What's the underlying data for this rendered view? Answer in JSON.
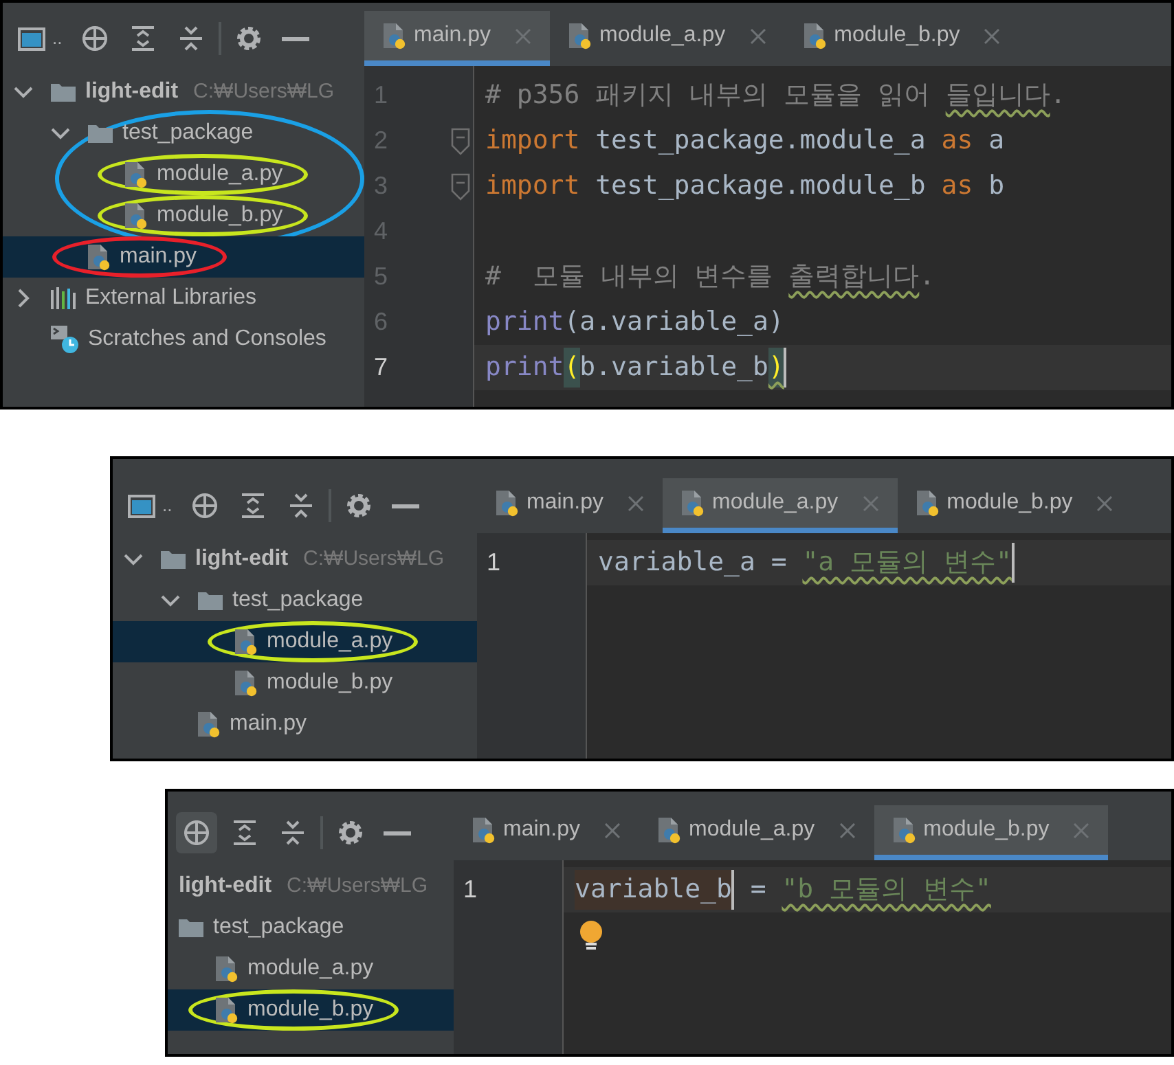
{
  "panels": [
    {
      "toolbar": [
        {
          "kind": "window",
          "label": "..",
          "hovered": false
        },
        {
          "kind": "locate",
          "hovered": false
        },
        {
          "kind": "expand",
          "hovered": false
        },
        {
          "kind": "collapse",
          "hovered": false
        },
        {
          "kind": "separator",
          "hovered": false
        },
        {
          "kind": "settings",
          "hovered": false
        },
        {
          "kind": "hide",
          "hovered": false
        }
      ],
      "tabs": [
        {
          "label": "main.py",
          "selected": true
        },
        {
          "label": "module_a.py",
          "selected": false
        },
        {
          "label": "module_b.py",
          "selected": false
        }
      ],
      "tree": {
        "hscrolled": false,
        "items": [
          {
            "label": "light-edit",
            "path": "C:₩Users₩LG",
            "kind": "folder",
            "expanded": true,
            "selected": false,
            "children": [
              {
                "label": "test_package",
                "kind": "folder",
                "expanded": true,
                "selected": false,
                "annotation": {
                  "kind": "group",
                  "color": "#1aa0e6"
                },
                "children": [
                  {
                    "label": "module_a.py",
                    "kind": "python",
                    "selected": false,
                    "annotation": {
                      "kind": "row",
                      "color": "#c8e61e"
                    }
                  },
                  {
                    "label": "module_b.py",
                    "kind": "python",
                    "selected": false,
                    "annotation": {
                      "kind": "row",
                      "color": "#c8e61e"
                    }
                  }
                ]
              },
              {
                "label": "main.py",
                "kind": "python",
                "selected": true,
                "annotation": {
                  "kind": "row",
                  "color": "#e8202a"
                }
              }
            ]
          },
          {
            "label": "External Libraries",
            "kind": "libraries",
            "expanded": false,
            "selected": false
          },
          {
            "label": "Scratches and Consoles",
            "kind": "scratches",
            "selected": false
          }
        ]
      },
      "editor": {
        "bulb": false,
        "lines": [
          {
            "number": "1",
            "current": false,
            "fold": false,
            "segments": [
              {
                "text": "# p356 패키지 내부의 모듈을 읽어 ",
                "kind": "comment"
              },
              {
                "text": "들입니다",
                "kind": "comment",
                "warn": true
              },
              {
                "text": ".",
                "kind": "comment"
              }
            ]
          },
          {
            "number": "2",
            "current": false,
            "fold": true,
            "segments": [
              {
                "text": "import",
                "kind": "keyword"
              },
              {
                "text": " test_package.module_a ",
                "kind": "plain"
              },
              {
                "text": "as",
                "kind": "keyword"
              },
              {
                "text": " a",
                "kind": "plain"
              }
            ]
          },
          {
            "number": "3",
            "current": false,
            "fold": true,
            "segments": [
              {
                "text": "import",
                "kind": "keyword"
              },
              {
                "text": " test_package.module_b ",
                "kind": "plain"
              },
              {
                "text": "as",
                "kind": "keyword"
              },
              {
                "text": " b",
                "kind": "plain"
              }
            ]
          },
          {
            "number": "4",
            "current": false,
            "fold": false
          },
          {
            "number": "5",
            "current": false,
            "fold": false,
            "segments": [
              {
                "text": "#  모듈 내부의 변수를 ",
                "kind": "comment"
              },
              {
                "text": "출력합니다",
                "kind": "comment",
                "warn": true
              },
              {
                "text": ".",
                "kind": "comment"
              }
            ]
          },
          {
            "number": "6",
            "current": false,
            "fold": false,
            "segments": [
              {
                "text": "print",
                "kind": "builtin"
              },
              {
                "text": "(a.variable_a)",
                "kind": "plain"
              }
            ]
          },
          {
            "number": "7",
            "current": true,
            "fold": false,
            "segments": [
              {
                "text": "print",
                "kind": "builtin"
              },
              {
                "text": "(",
                "kind": "brace",
                "matched": true
              },
              {
                "text": "b.variable_b",
                "kind": "plain"
              },
              {
                "text": ")",
                "kind": "brace",
                "matched": true,
                "warn": true,
                "caret": true
              }
            ]
          }
        ]
      }
    },
    {
      "toolbar": [
        {
          "kind": "window",
          "label": "..",
          "hovered": false
        },
        {
          "kind": "locate",
          "hovered": false
        },
        {
          "kind": "expand",
          "hovered": false
        },
        {
          "kind": "collapse",
          "hovered": false
        },
        {
          "kind": "separator",
          "hovered": false
        },
        {
          "kind": "settings",
          "hovered": false
        },
        {
          "kind": "hide",
          "hovered": false
        }
      ],
      "tabs": [
        {
          "label": "main.py",
          "selected": false
        },
        {
          "label": "module_a.py",
          "selected": true
        },
        {
          "label": "module_b.py",
          "selected": false
        }
      ],
      "tree": {
        "hscrolled": false,
        "items": [
          {
            "label": "light-edit",
            "path": "C:₩Users₩LG",
            "kind": "folder",
            "expanded": true,
            "selected": false,
            "children": [
              {
                "label": "test_package",
                "kind": "folder",
                "expanded": true,
                "selected": false,
                "children": [
                  {
                    "label": "module_a.py",
                    "kind": "python",
                    "selected": true,
                    "annotation": {
                      "kind": "row",
                      "color": "#c8e61e"
                    }
                  },
                  {
                    "label": "module_b.py",
                    "kind": "python",
                    "selected": false
                  }
                ]
              },
              {
                "label": "main.py",
                "kind": "python",
                "selected": false
              }
            ]
          }
        ]
      },
      "editor": {
        "bulb": false,
        "lines": [
          {
            "number": "1",
            "current": true,
            "fold": false,
            "segments": [
              {
                "text": "variable_a = ",
                "kind": "plain"
              },
              {
                "text": "\"a 모듈의 변수\"",
                "kind": "string",
                "warn": true,
                "caret": true
              }
            ]
          }
        ]
      }
    },
    {
      "toolbar": [
        {
          "kind": "locate",
          "hovered": true
        },
        {
          "kind": "expand",
          "hovered": false
        },
        {
          "kind": "collapse",
          "hovered": false
        },
        {
          "kind": "separator",
          "hovered": false
        },
        {
          "kind": "settings",
          "hovered": false
        },
        {
          "kind": "hide",
          "hovered": false
        }
      ],
      "tabs": [
        {
          "label": "main.py",
          "selected": false
        },
        {
          "label": "module_a.py",
          "selected": false
        },
        {
          "label": "module_b.py",
          "selected": true
        }
      ],
      "tree": {
        "hscrolled": true,
        "items": [
          {
            "label": "light-edit",
            "path": "C:₩Users₩LG",
            "kind": "folder",
            "selected": false,
            "children": [
              {
                "label": "test_package",
                "kind": "folder",
                "selected": false,
                "children": [
                  {
                    "label": "module_a.py",
                    "kind": "python",
                    "selected": false
                  },
                  {
                    "label": "module_b.py",
                    "kind": "python",
                    "selected": true,
                    "annotation": {
                      "kind": "row",
                      "color": "#c8e61e"
                    }
                  }
                ]
              }
            ]
          }
        ]
      },
      "editor": {
        "bulb": true,
        "lines": [
          {
            "number": "1",
            "current": true,
            "fold": false,
            "segments": [
              {
                "text": "variable_b",
                "kind": "plain",
                "marked": true,
                "caret": true
              },
              {
                "text": " = ",
                "kind": "plain"
              },
              {
                "text": "\"b 모듈의 변수\"",
                "kind": "string",
                "warn": true
              }
            ]
          }
        ]
      }
    }
  ]
}
